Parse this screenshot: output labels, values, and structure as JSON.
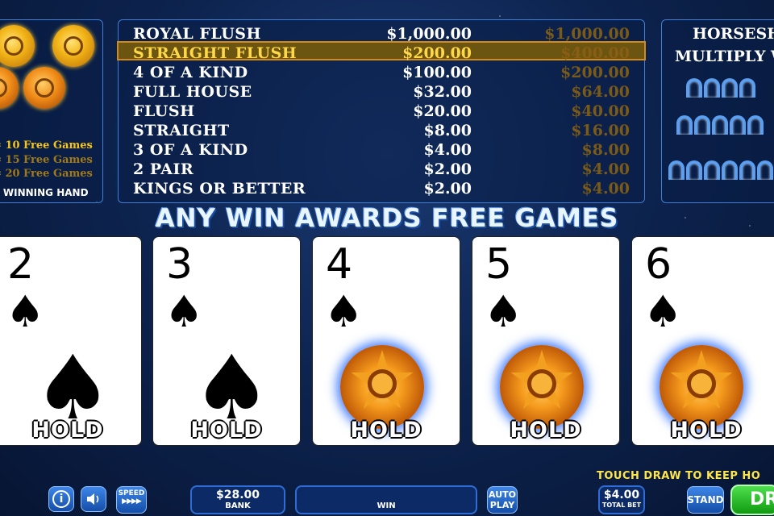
{
  "free_games": {
    "lines": [
      {
        "eq": "=",
        "text": "10 Free Games"
      },
      {
        "eq": "=",
        "text": "15 Free Games"
      },
      {
        "eq": "=",
        "text": "20 Free Games"
      }
    ],
    "any_prefix": "Y",
    "winning_hand": "WINNING HAND"
  },
  "paytable": {
    "highlighted_index": 1,
    "rows": [
      {
        "hand": "ROYAL FLUSH",
        "pay1": "$1,000.00",
        "pay2": "$1,000.00"
      },
      {
        "hand": "STRAIGHT FLUSH",
        "pay1": "$200.00",
        "pay2": "$400.00"
      },
      {
        "hand": "4 OF A KIND",
        "pay1": "$100.00",
        "pay2": "$200.00"
      },
      {
        "hand": "FULL HOUSE",
        "pay1": "$32.00",
        "pay2": "$64.00"
      },
      {
        "hand": "FLUSH",
        "pay1": "$20.00",
        "pay2": "$40.00"
      },
      {
        "hand": "STRAIGHT",
        "pay1": "$8.00",
        "pay2": "$16.00"
      },
      {
        "hand": "3 OF A KIND",
        "pay1": "$4.00",
        "pay2": "$8.00"
      },
      {
        "hand": "2 PAIR",
        "pay1": "$2.00",
        "pay2": "$4.00"
      },
      {
        "hand": "KINGS OR BETTER",
        "pay1": "$2.00",
        "pay2": "$4.00"
      }
    ]
  },
  "horseshoe": {
    "title_line1": "HORSESHO",
    "title_line2": "MULTIPLY W"
  },
  "banner": "ANY WIN AWARDS FREE GAMES",
  "cards": [
    {
      "rank": "2",
      "suit": "♠",
      "wild": false,
      "hold_label": "HOLD"
    },
    {
      "rank": "3",
      "suit": "♠",
      "wild": false,
      "hold_label": "HOLD"
    },
    {
      "rank": "4",
      "suit": "♠",
      "wild": true,
      "hold_label": "HOLD"
    },
    {
      "rank": "5",
      "suit": "♠",
      "wild": true,
      "hold_label": "HOLD"
    },
    {
      "rank": "6",
      "suit": "♠",
      "wild": true,
      "hold_label": "HOLD"
    }
  ],
  "hint": "TOUCH DRAW TO KEEP HO",
  "controls": {
    "info_icon": "i",
    "speed_label": "SPEED",
    "speed_arrows": "▶▶▶▶",
    "bank_value": "$28.00",
    "bank_label": "BANK",
    "win_value": "",
    "win_label": "WIN",
    "auto_line1": "AUTO",
    "auto_line2": "PLAY",
    "total_bet_value": "$4.00",
    "total_bet_label": "TOTAL BET",
    "stand_label": "STAND",
    "draw_label": "DR"
  },
  "colors": {
    "accent_gold": "#f5c518",
    "highlight_border": "#d28b1a",
    "button_blue": "#1e63c8",
    "draw_green": "#22b422"
  }
}
